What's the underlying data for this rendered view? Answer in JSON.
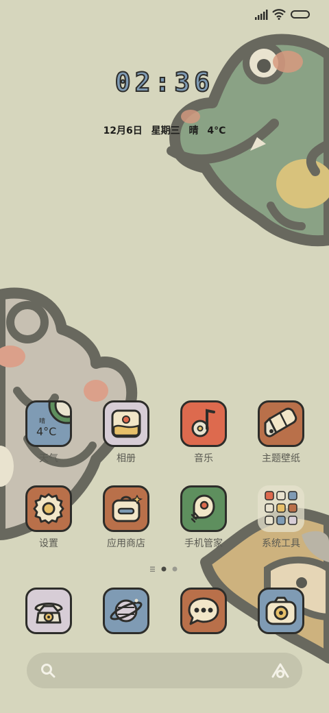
{
  "status_bar": {
    "icons": [
      "signal-icon",
      "wifi-icon",
      "battery-icon"
    ]
  },
  "lockscreen": {
    "time": "02:36",
    "date": "12月6日",
    "weekday": "星期三",
    "weather": "晴",
    "temperature": "4°C"
  },
  "weather_widget": {
    "condition": "晴",
    "temp": "4°C"
  },
  "apps_row1": [
    {
      "label": "天气",
      "icon": "weather-icon"
    },
    {
      "label": "相册",
      "icon": "gallery-icon"
    },
    {
      "label": "音乐",
      "icon": "music-icon"
    },
    {
      "label": "主题壁纸",
      "icon": "theme-brush-icon"
    }
  ],
  "apps_row2": [
    {
      "label": "设置",
      "icon": "settings-gear-icon"
    },
    {
      "label": "应用商店",
      "icon": "app-store-icon"
    },
    {
      "label": "手机管家",
      "icon": "security-manager-icon"
    },
    {
      "label": "系统工具",
      "icon": "folder-icon"
    }
  ],
  "page_indicator": {
    "pages": 2,
    "current": 1
  },
  "dock": [
    {
      "icon": "phone-icon"
    },
    {
      "icon": "browser-planet-icon"
    },
    {
      "icon": "messages-icon"
    },
    {
      "icon": "camera-icon"
    }
  ],
  "search_bar": {
    "icons": [
      "search-icon",
      "assistant-icon"
    ]
  },
  "colors": {
    "background": "#d6d6bd",
    "outline": "#2d2d2a",
    "blue": "#7f9bb4",
    "orange": "#b9704a",
    "red": "#dd6a4e",
    "green": "#5e8f5e",
    "lavender": "#d7cdd6"
  }
}
